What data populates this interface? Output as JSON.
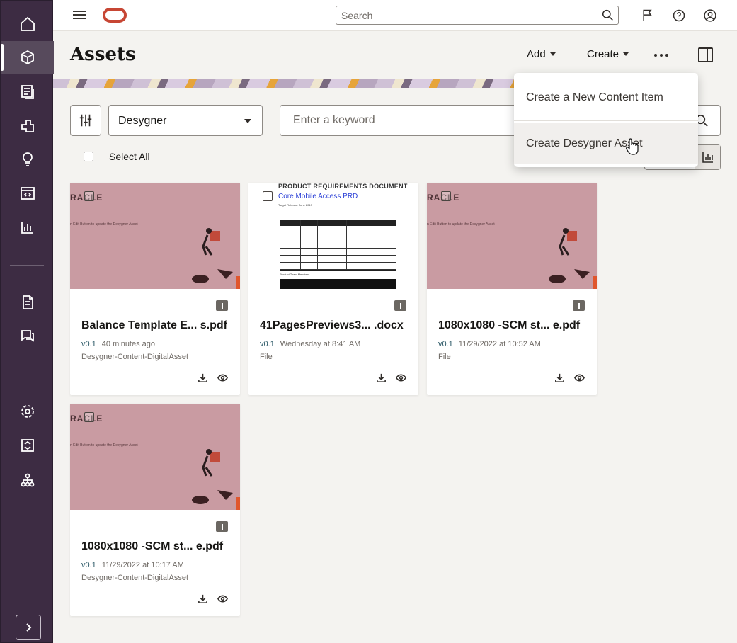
{
  "topbar": {
    "search_placeholder": "Search"
  },
  "page": {
    "title": "Assets",
    "add_label": "Add",
    "create_label": "Create"
  },
  "filters": {
    "repository_value": "Desygner",
    "keyword_placeholder": "Enter a keyword",
    "select_all_label": "Select All"
  },
  "menu": {
    "items": [
      {
        "label": "Create a New Content Item"
      },
      {
        "label": "Create Desygner Asset"
      }
    ]
  },
  "cards": [
    {
      "title": "Balance Template E... s.pdf",
      "version": "v0.1",
      "time": "40 minutes ago",
      "sub": "Desygner-Content-DigitalAsset",
      "thumb_brand": "RACLE",
      "thumb_text": "n Edit Button to update the Desygner Asset"
    },
    {
      "title": "41PagesPreviews3... .docx",
      "version": "v0.1",
      "time": "Wednesday at 8:41 AM",
      "sub": "File",
      "doc_head": "PRODUCT REQUIREMENTS DOCUMENT",
      "doc_link": "Core Mobile Access PRD",
      "doc_small": "Target Release: June 2013",
      "doc_label": "Product Team Members"
    },
    {
      "title": "1080x1080 -SCM st... e.pdf",
      "version": "v0.1",
      "time": "11/29/2022 at 10:52 AM",
      "sub": "File",
      "thumb_brand": "RACLE",
      "thumb_text": "n Edit Button to update the Desygner Asset"
    },
    {
      "title": "1080x1080 -SCM st... e.pdf",
      "version": "v0.1",
      "time": "11/29/2022 at 10:17 AM",
      "sub": "Desygner-Content-DigitalAsset",
      "thumb_brand": "RACLE",
      "thumb_text": "n Edit Button to update the Desygner Asset"
    }
  ],
  "colors": {
    "rail": "#3d2c43",
    "brand": "#c74634",
    "thumb": "#c99ba2"
  }
}
